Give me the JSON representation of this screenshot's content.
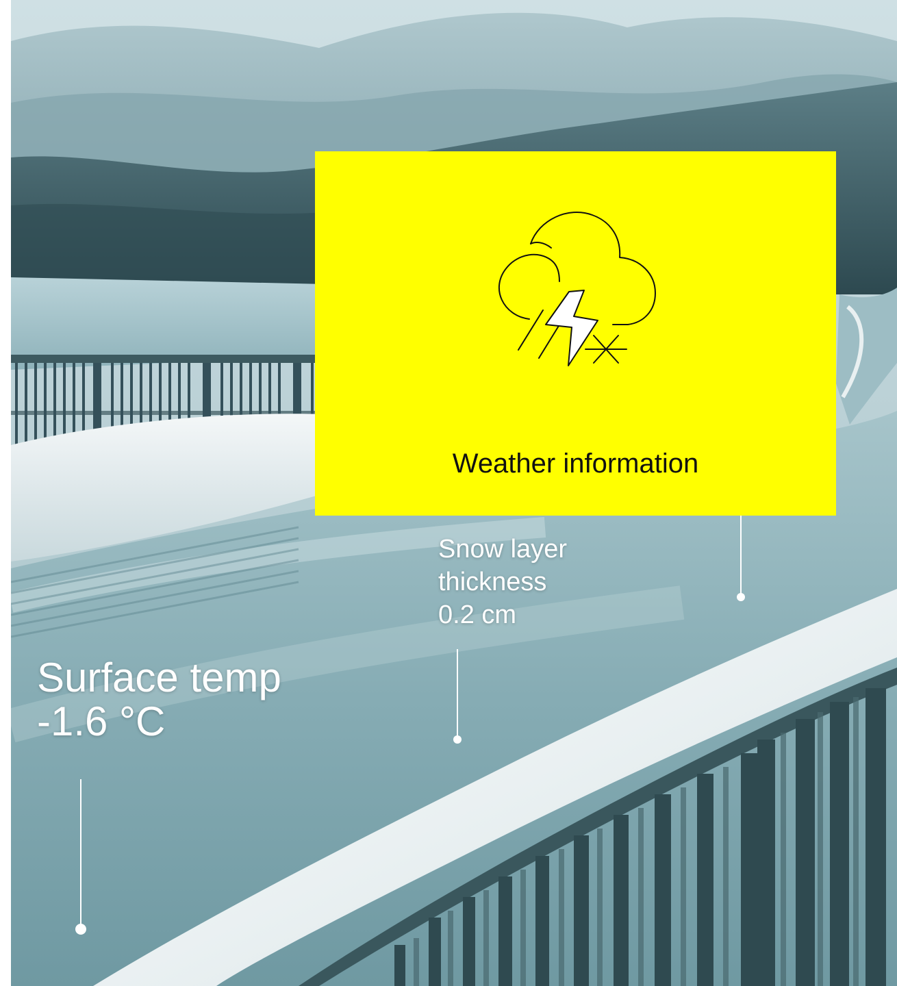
{
  "colors": {
    "card_background": "#ffff00",
    "label_text": "#ffffff",
    "sky": "#c9dde3",
    "ice_road": "#8fb3ba"
  },
  "info_card": {
    "icon": "cloud-lightning-rain-snow-icon",
    "title": "Weather information"
  },
  "measurements": {
    "surface_temp": {
      "label": "Surface temp",
      "value": "-1.6 °C"
    },
    "snow_layer": {
      "label_line1": "Snow layer",
      "label_line2": "thickness",
      "value": "0.2 cm"
    }
  }
}
